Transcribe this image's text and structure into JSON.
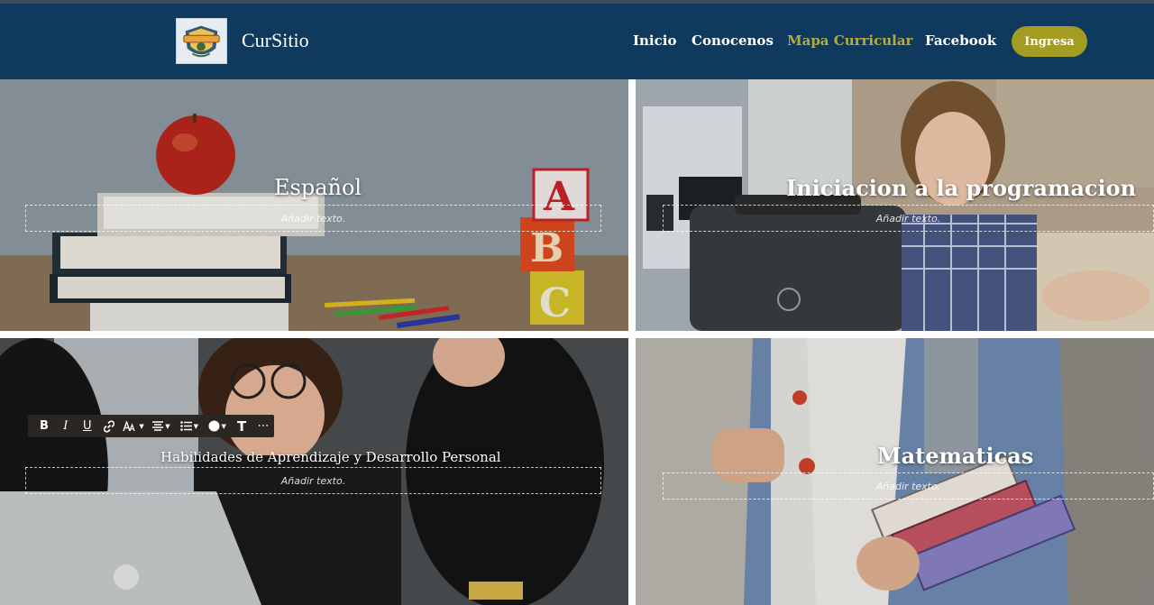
{
  "header": {
    "brand": "CurSitio",
    "nav": [
      "Inicio",
      "Conocenos",
      "Mapa Curricular",
      "Facebook"
    ],
    "active_nav": "Mapa Curricular",
    "login_label": "Ingresa"
  },
  "tiles": [
    {
      "title": "Español",
      "placeholder": "Añadir texto."
    },
    {
      "title": "Iniciacion a la programacion",
      "placeholder": "Añadir texto."
    },
    {
      "title": "Habilidades  de Aprendizaje y Desarrollo Personal",
      "placeholder": "Añadir texto."
    },
    {
      "title": "Matematicas",
      "placeholder": "Añadir texto."
    }
  ],
  "toolbar": {
    "bold": "B",
    "italic": "I",
    "underline": "U",
    "text_style": "T",
    "more": "⋯",
    "icons": [
      "bold-icon",
      "italic-icon",
      "underline-icon",
      "link-icon",
      "font-size-icon",
      "align-icon",
      "list-icon",
      "color-icon",
      "text-style-icon",
      "more-icon"
    ]
  },
  "colors": {
    "header_bg": "#0f3a5e",
    "accent": "#a49b22",
    "active_nav": "#b9ab3a"
  }
}
